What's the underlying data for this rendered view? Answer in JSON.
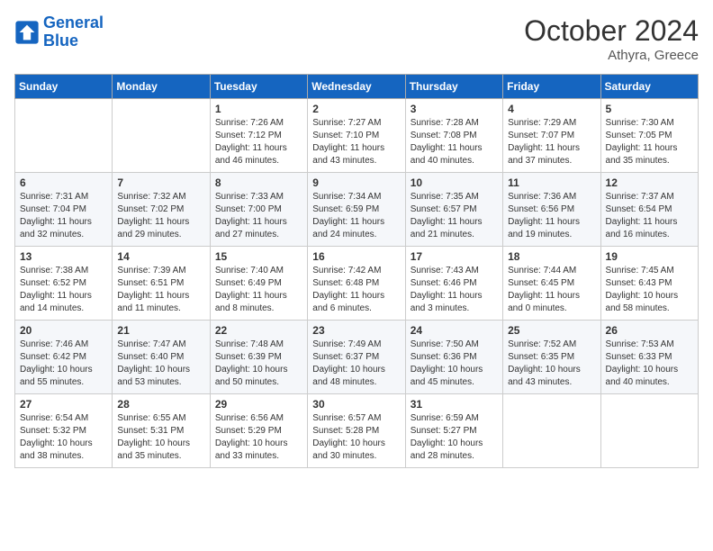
{
  "header": {
    "logo_line1": "General",
    "logo_line2": "Blue",
    "month": "October 2024",
    "location": "Athyra, Greece"
  },
  "weekdays": [
    "Sunday",
    "Monday",
    "Tuesday",
    "Wednesday",
    "Thursday",
    "Friday",
    "Saturday"
  ],
  "weeks": [
    [
      {
        "day": "",
        "info": ""
      },
      {
        "day": "",
        "info": ""
      },
      {
        "day": "1",
        "info": "Sunrise: 7:26 AM\nSunset: 7:12 PM\nDaylight: 11 hours and 46 minutes."
      },
      {
        "day": "2",
        "info": "Sunrise: 7:27 AM\nSunset: 7:10 PM\nDaylight: 11 hours and 43 minutes."
      },
      {
        "day": "3",
        "info": "Sunrise: 7:28 AM\nSunset: 7:08 PM\nDaylight: 11 hours and 40 minutes."
      },
      {
        "day": "4",
        "info": "Sunrise: 7:29 AM\nSunset: 7:07 PM\nDaylight: 11 hours and 37 minutes."
      },
      {
        "day": "5",
        "info": "Sunrise: 7:30 AM\nSunset: 7:05 PM\nDaylight: 11 hours and 35 minutes."
      }
    ],
    [
      {
        "day": "6",
        "info": "Sunrise: 7:31 AM\nSunset: 7:04 PM\nDaylight: 11 hours and 32 minutes."
      },
      {
        "day": "7",
        "info": "Sunrise: 7:32 AM\nSunset: 7:02 PM\nDaylight: 11 hours and 29 minutes."
      },
      {
        "day": "8",
        "info": "Sunrise: 7:33 AM\nSunset: 7:00 PM\nDaylight: 11 hours and 27 minutes."
      },
      {
        "day": "9",
        "info": "Sunrise: 7:34 AM\nSunset: 6:59 PM\nDaylight: 11 hours and 24 minutes."
      },
      {
        "day": "10",
        "info": "Sunrise: 7:35 AM\nSunset: 6:57 PM\nDaylight: 11 hours and 21 minutes."
      },
      {
        "day": "11",
        "info": "Sunrise: 7:36 AM\nSunset: 6:56 PM\nDaylight: 11 hours and 19 minutes."
      },
      {
        "day": "12",
        "info": "Sunrise: 7:37 AM\nSunset: 6:54 PM\nDaylight: 11 hours and 16 minutes."
      }
    ],
    [
      {
        "day": "13",
        "info": "Sunrise: 7:38 AM\nSunset: 6:52 PM\nDaylight: 11 hours and 14 minutes."
      },
      {
        "day": "14",
        "info": "Sunrise: 7:39 AM\nSunset: 6:51 PM\nDaylight: 11 hours and 11 minutes."
      },
      {
        "day": "15",
        "info": "Sunrise: 7:40 AM\nSunset: 6:49 PM\nDaylight: 11 hours and 8 minutes."
      },
      {
        "day": "16",
        "info": "Sunrise: 7:42 AM\nSunset: 6:48 PM\nDaylight: 11 hours and 6 minutes."
      },
      {
        "day": "17",
        "info": "Sunrise: 7:43 AM\nSunset: 6:46 PM\nDaylight: 11 hours and 3 minutes."
      },
      {
        "day": "18",
        "info": "Sunrise: 7:44 AM\nSunset: 6:45 PM\nDaylight: 11 hours and 0 minutes."
      },
      {
        "day": "19",
        "info": "Sunrise: 7:45 AM\nSunset: 6:43 PM\nDaylight: 10 hours and 58 minutes."
      }
    ],
    [
      {
        "day": "20",
        "info": "Sunrise: 7:46 AM\nSunset: 6:42 PM\nDaylight: 10 hours and 55 minutes."
      },
      {
        "day": "21",
        "info": "Sunrise: 7:47 AM\nSunset: 6:40 PM\nDaylight: 10 hours and 53 minutes."
      },
      {
        "day": "22",
        "info": "Sunrise: 7:48 AM\nSunset: 6:39 PM\nDaylight: 10 hours and 50 minutes."
      },
      {
        "day": "23",
        "info": "Sunrise: 7:49 AM\nSunset: 6:37 PM\nDaylight: 10 hours and 48 minutes."
      },
      {
        "day": "24",
        "info": "Sunrise: 7:50 AM\nSunset: 6:36 PM\nDaylight: 10 hours and 45 minutes."
      },
      {
        "day": "25",
        "info": "Sunrise: 7:52 AM\nSunset: 6:35 PM\nDaylight: 10 hours and 43 minutes."
      },
      {
        "day": "26",
        "info": "Sunrise: 7:53 AM\nSunset: 6:33 PM\nDaylight: 10 hours and 40 minutes."
      }
    ],
    [
      {
        "day": "27",
        "info": "Sunrise: 6:54 AM\nSunset: 5:32 PM\nDaylight: 10 hours and 38 minutes."
      },
      {
        "day": "28",
        "info": "Sunrise: 6:55 AM\nSunset: 5:31 PM\nDaylight: 10 hours and 35 minutes."
      },
      {
        "day": "29",
        "info": "Sunrise: 6:56 AM\nSunset: 5:29 PM\nDaylight: 10 hours and 33 minutes."
      },
      {
        "day": "30",
        "info": "Sunrise: 6:57 AM\nSunset: 5:28 PM\nDaylight: 10 hours and 30 minutes."
      },
      {
        "day": "31",
        "info": "Sunrise: 6:59 AM\nSunset: 5:27 PM\nDaylight: 10 hours and 28 minutes."
      },
      {
        "day": "",
        "info": ""
      },
      {
        "day": "",
        "info": ""
      }
    ]
  ]
}
